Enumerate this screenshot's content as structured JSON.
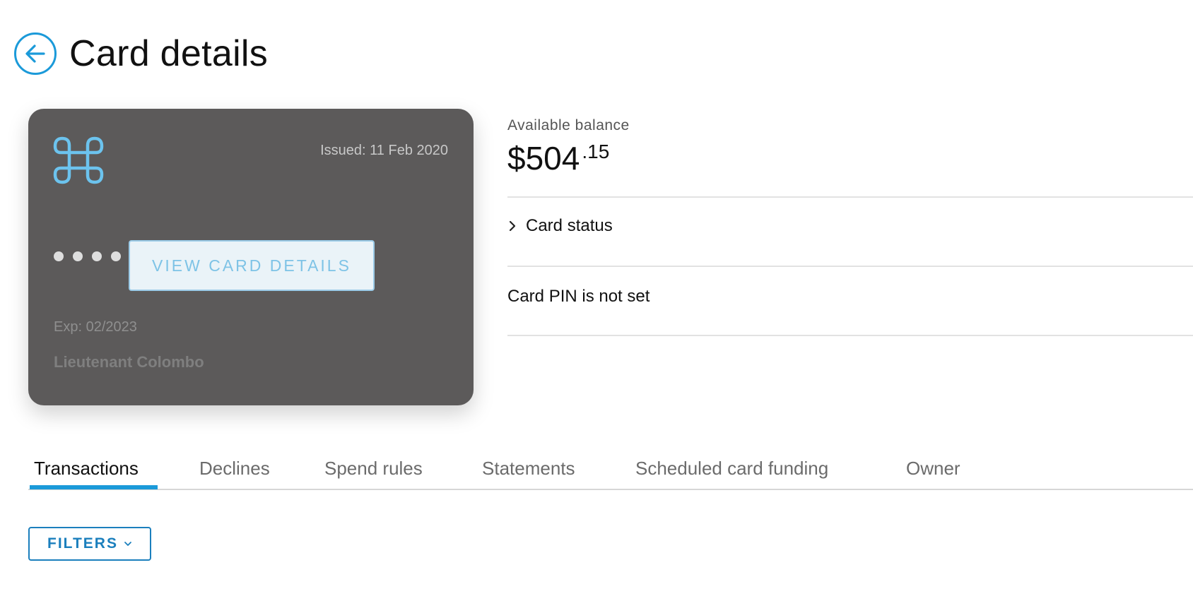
{
  "header": {
    "title": "Card details",
    "back_icon": "back-arrow-icon"
  },
  "card": {
    "issued": "Issued: 11 Feb 2020",
    "masked_number_dots": 4,
    "view_details_label": "VIEW CARD DETAILS",
    "expiry": "Exp: 02/2023",
    "holder_name": "Lieutenant Colombo",
    "logo_icon": "command-key-logo-icon",
    "background_color": "#5c5a5a",
    "accent_color": "#7ec3e6"
  },
  "balance": {
    "label": "Available balance",
    "main": "$504",
    "cents": ".15"
  },
  "rows": {
    "card_status_label": "Card status",
    "card_status_icon": "chevron-right-icon",
    "pin_status": "Card PIN is not set"
  },
  "tabs": [
    {
      "label": "Transactions",
      "active": true
    },
    {
      "label": "Declines",
      "active": false
    },
    {
      "label": "Spend rules",
      "active": false
    },
    {
      "label": "Statements",
      "active": false
    },
    {
      "label": "Scheduled card funding",
      "active": false
    },
    {
      "label": "Owner",
      "active": false
    }
  ],
  "filters": {
    "label": "FILTERS",
    "icon": "chevron-down-icon"
  },
  "colors": {
    "brand_blue": "#1b9ad9",
    "filter_blue": "#1b7fbd"
  }
}
